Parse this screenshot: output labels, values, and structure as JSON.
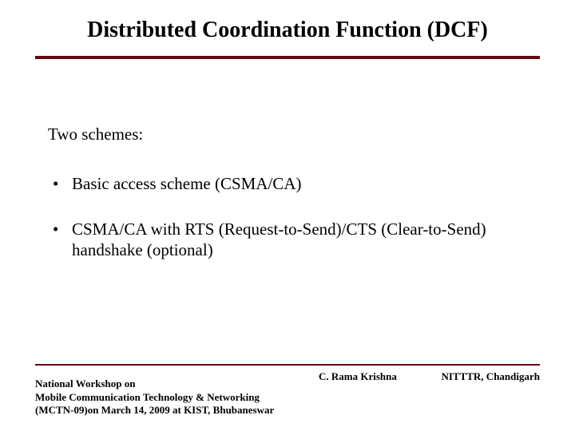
{
  "title": "Distributed Coordination Function (DCF)",
  "intro": "Two schemes:",
  "bullets": [
    "Basic access scheme (CSMA/CA)",
    "CSMA/CA with RTS (Request-to-Send)/CTS (Clear-to-Send) handshake (optional)"
  ],
  "footer": {
    "left_line1": "National Workshop on",
    "left_line2": "Mobile Communication Technology & Networking",
    "left_line3": "(MCTN-09)on  March 14, 2009 at KIST, Bhubaneswar",
    "center": "C. Rama Krishna",
    "right": "NITTTR, Chandigarh"
  }
}
